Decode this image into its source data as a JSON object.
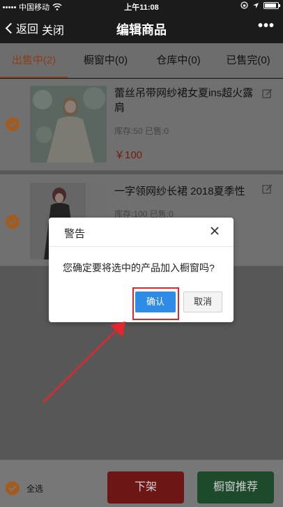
{
  "status_bar": {
    "carrier": "中国移动",
    "time": "上午11:08"
  },
  "nav": {
    "back_label": "返回",
    "close_label": "关闭",
    "title": "编辑商品",
    "more_label": "•••"
  },
  "tabs": [
    {
      "label": "出售中(2)",
      "active": true
    },
    {
      "label": "橱窗中(0)",
      "active": false
    },
    {
      "label": "仓库中(0)",
      "active": false
    },
    {
      "label": "已售完(0)",
      "active": false
    }
  ],
  "products": [
    {
      "title": "蕾丝吊带网纱裙女夏ins超火露肩",
      "meta": "库存:50 已售:0",
      "price": "￥100",
      "checked": true
    },
    {
      "title": "一字领网纱长裙 2018夏季性",
      "meta": "库存:100 已售:0",
      "price": "",
      "checked": true
    }
  ],
  "bottom": {
    "select_all_label": "全选",
    "delist_label": "下架",
    "recommend_label": "橱窗推荐"
  },
  "dialog": {
    "title": "警告",
    "message": "您确定要将选中的产品加入橱窗吗?",
    "confirm_label": "确认",
    "cancel_label": "取消"
  },
  "colors": {
    "accent": "#e07a2c",
    "confirm": "#2e8ce6",
    "highlight": "#e3262b",
    "delist": "#d32f2f",
    "recommend": "#2e8b57"
  }
}
